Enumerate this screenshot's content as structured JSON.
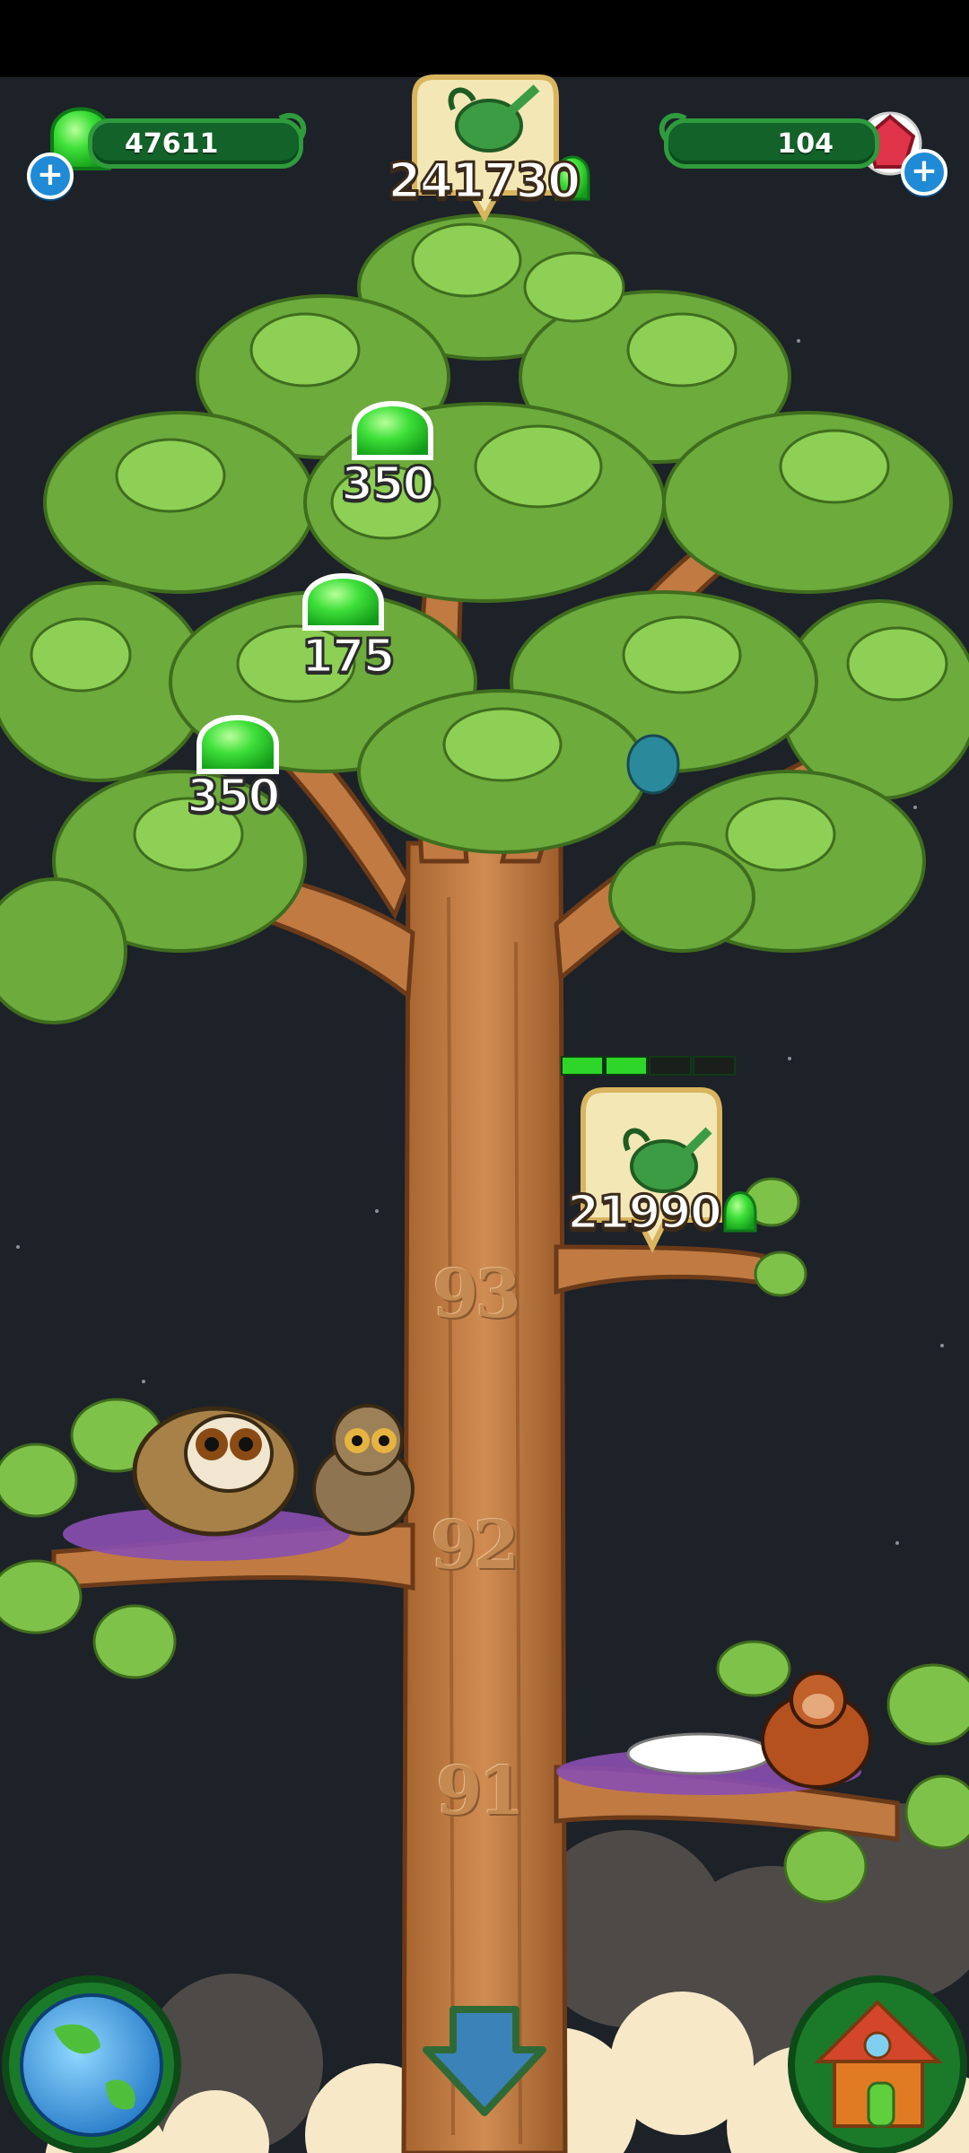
{
  "hud": {
    "left_currency": {
      "value": "47611",
      "icon": "green-gem-icon",
      "plus_icon": "plus-icon"
    },
    "right_currency": {
      "value": "104",
      "icon": "red-crystal-icon",
      "plus_icon": "plus-icon"
    },
    "top_counter": {
      "value": "241730",
      "icon": "watering-can-icon",
      "unit_icon": "green-gem-icon"
    }
  },
  "tree": {
    "collectibles": [
      {
        "value": "350",
        "icon": "green-gem-icon"
      },
      {
        "value": "175",
        "icon": "green-gem-icon"
      },
      {
        "value": "350",
        "icon": "green-gem-icon"
      }
    ],
    "watering": {
      "value": "21990",
      "icon": "watering-can-icon",
      "progress_filled": 2,
      "progress_total": 4
    },
    "floors": [
      "93",
      "92",
      "91"
    ]
  },
  "bottom_bar": {
    "left_icon": "globe-icon",
    "center_icon": "scroll-down-arrow-icon",
    "right_icon": "house-icon"
  },
  "colors": {
    "background": "#1d2128",
    "leaf": "#7fc24a",
    "trunk": "#c07a42",
    "gem": "#3fe03a",
    "hud_bar": "#12622a"
  }
}
